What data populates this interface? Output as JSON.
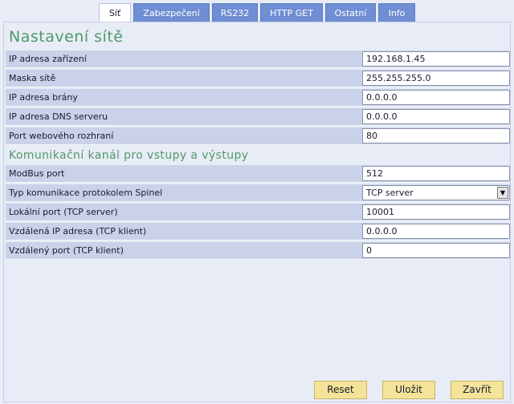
{
  "tabs": [
    {
      "label": "Síť",
      "active": true
    },
    {
      "label": "Zabezpečení",
      "active": false
    },
    {
      "label": "RS232",
      "active": false
    },
    {
      "label": "HTTP GET",
      "active": false
    },
    {
      "label": "Ostatní",
      "active": false
    },
    {
      "label": "Info",
      "active": false
    }
  ],
  "network": {
    "title": "Nastavení sítě",
    "fields": [
      {
        "label": "IP adresa zařízení",
        "value": "192.168.1.45"
      },
      {
        "label": "Maska sítě",
        "value": "255.255.255.0"
      },
      {
        "label": "IP adresa brány",
        "value": "0.0.0.0"
      },
      {
        "label": "IP adresa DNS serveru",
        "value": "0.0.0.0"
      },
      {
        "label": "Port webového rozhraní",
        "value": "80"
      }
    ]
  },
  "comm": {
    "title": "Komunikační kanál pro vstupy a výstupy",
    "fields": [
      {
        "label": "ModBus port",
        "value": "512"
      },
      {
        "label": "Typ komunikace protokolem Spinel",
        "value": "TCP server"
      },
      {
        "label": "Lokální port (TCP server)",
        "value": "10001"
      },
      {
        "label": "Vzdálená IP adresa (TCP klient)",
        "value": "0.0.0.0"
      },
      {
        "label": "Vzdálený port (TCP klient)",
        "value": "0"
      }
    ]
  },
  "buttons": {
    "reset": "Reset",
    "save": "Uložit",
    "close": "Zavřít"
  },
  "colors": {
    "tab": "#6f8ed3",
    "heading": "#4f9a6a",
    "row": "#c9d2e8",
    "button": "#f4e49a"
  }
}
